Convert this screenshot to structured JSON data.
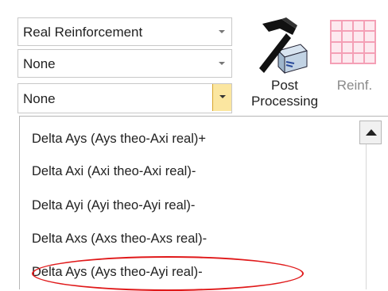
{
  "ribbon": {
    "combo1": {
      "value": "Real Reinforcement"
    },
    "combo2": {
      "value": "None"
    },
    "combo3": {
      "value": "None"
    },
    "post_processing": {
      "line1": "Post",
      "line2": "Processing"
    },
    "reinf": {
      "label": "Reinf."
    }
  },
  "dropdown": {
    "items": [
      "Delta Ays (Ays theo-Axi  real)+",
      "Delta Axi (Axi theo-Axi real)-",
      "Delta Ayi (Ayi theo-Ayi real)-",
      "Delta Axs (Axs theo-Axs real)-",
      "Delta Ays (Ays theo-Ayi  real)-"
    ],
    "highlighted_index": 4,
    "highlight_color": "#e0191a"
  },
  "colors": {
    "dropdown_button_bg": "#fbe6a0",
    "reinf_icon_color": "#f4a0b6"
  }
}
